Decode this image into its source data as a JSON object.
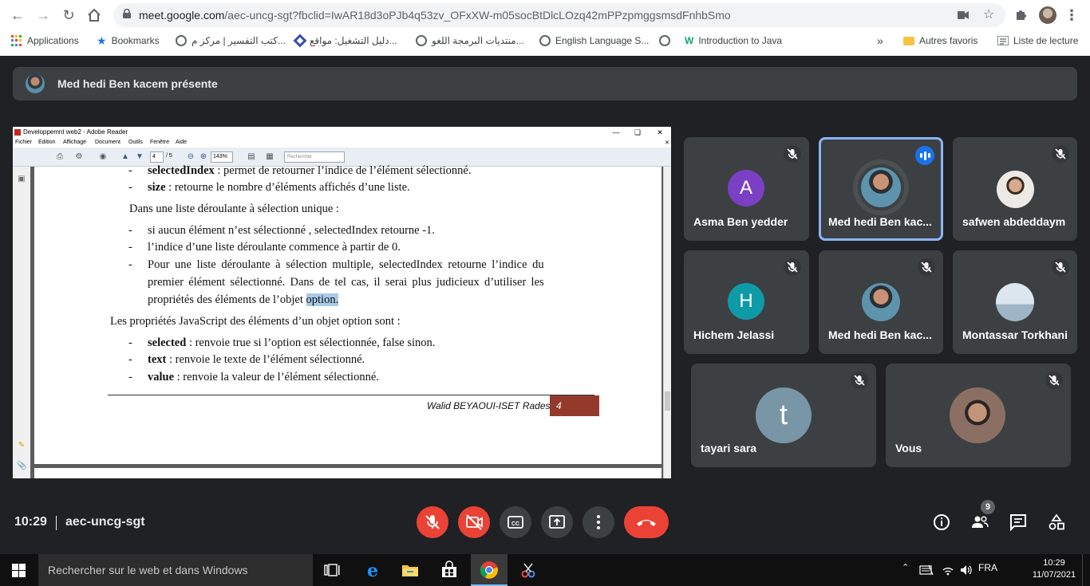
{
  "browser": {
    "url_host": "meet.google.com",
    "url_path": "/aec-uncg-sgt?fbclid=IwAR18d3oPJb4q53zv_OFxXW-m05socBtDlcLOzq42mPPzpmggsmsdFnhbSmo",
    "bookmarks": [
      {
        "label": "Applications",
        "icon": "apps-grid-icon"
      },
      {
        "label": "Bookmarks",
        "icon": "star-icon"
      },
      {
        "label": "كتب التفسير | مركز م...",
        "icon": "globe-icon"
      },
      {
        "label": "دليل التشغيل: مواقع...",
        "icon": "diamond-icon"
      },
      {
        "label": "منتديات البرمجة اللغو...",
        "icon": "globe-icon"
      },
      {
        "label": "English Language S...",
        "icon": "globe-icon"
      },
      {
        "label": "Introduction to Java",
        "icon": "w3-icon"
      }
    ],
    "more_bookmarks": "»",
    "other_favorites": "Autres favoris",
    "reading_list": "Liste de lecture"
  },
  "meet": {
    "presenting_label": "Med hedi Ben kacem présente",
    "time": "10:29",
    "meeting_code": "aec-uncg-sgt",
    "participant_count": "9",
    "participants": [
      {
        "name": "Asma Ben yedder",
        "initial": "A",
        "avatar_color": "#7b3fc4",
        "muted": true
      },
      {
        "name": "Med hedi Ben kac...",
        "initial": "",
        "avatar_color": "#5a8fa8",
        "muted": false,
        "speaking": true
      },
      {
        "name": "safwen abdeddaym",
        "initial": "",
        "avatar_color": "#e6e2de",
        "muted": true
      },
      {
        "name": "Hichem Jelassi",
        "initial": "H",
        "avatar_color": "#0e9aa7",
        "muted": true
      },
      {
        "name": "Med hedi Ben kac...",
        "initial": "",
        "avatar_color": "#5a8fa8",
        "muted": true
      },
      {
        "name": "Montassar Torkhani",
        "initial": "",
        "avatar_color": "#c7d6e3",
        "muted": true
      },
      {
        "name": "tayari sara",
        "initial": "t",
        "avatar_color": "#7896a6",
        "muted": true
      },
      {
        "name": "Vous",
        "initial": "",
        "avatar_color": "#8c6f63",
        "muted": true
      }
    ]
  },
  "reader": {
    "window_title": "Developpemnt web2 - Adobe Reader",
    "menu": [
      "Fichier",
      "Edition",
      "Affichage",
      "Document",
      "Outils",
      "Fenêtre",
      "Aide"
    ],
    "page_current": "4",
    "page_total": "/ 5",
    "zoom": "143%",
    "search_placeholder": "Rechercher",
    "doc": {
      "l1_bold": "selectedIndex",
      "l1_rest": " : permet de retourner l’indice de l’élément sélectionné.",
      "l2_bold": "size",
      "l2_rest": " : retourne le nombre d’éléments affichés d’une liste.",
      "p1": "Dans une liste déroulante à sélection unique  :",
      "l3": "si aucun élément n’est sélectionné , selectedIndex retourne -1.",
      "l4": "l’indice d’une liste déroulante commence à partir de 0.",
      "l5a": "Pour une liste déroulante à sélection multiple, selectedIndex retourne l’indice du",
      "l5b": "premier élément sélectionné. Dans de tel cas, il serai plus judicieux d’utiliser les",
      "l5c": "propriétés des éléments de l’objet ",
      "l5c_hl": "option.",
      "p2": "Les propriétés JavaScript des éléments d’un objet option sont :",
      "l6_bold": "selected",
      "l6_rest": " : renvoie true si l’option est sélectionnée, false sinon.",
      "l7_bold": "text",
      "l7_rest": " : renvoie le texte de l’élément sélectionné.",
      "l8_bold": "value",
      "l8_rest": " : renvoie la valeur de l’élément sélectionné.",
      "footer_author": "Walid BEYAOUI-ISET Rades",
      "footer_page": "4"
    }
  },
  "taskbar": {
    "search_placeholder": "Rechercher sur le web et dans Windows",
    "language": "FRA",
    "time": "10:29",
    "date": "11/07/2021"
  },
  "colors": {
    "meet_bg": "#202124",
    "tile_bg": "#3c4043",
    "danger": "#ea4335",
    "accent": "#8ab4f8"
  }
}
